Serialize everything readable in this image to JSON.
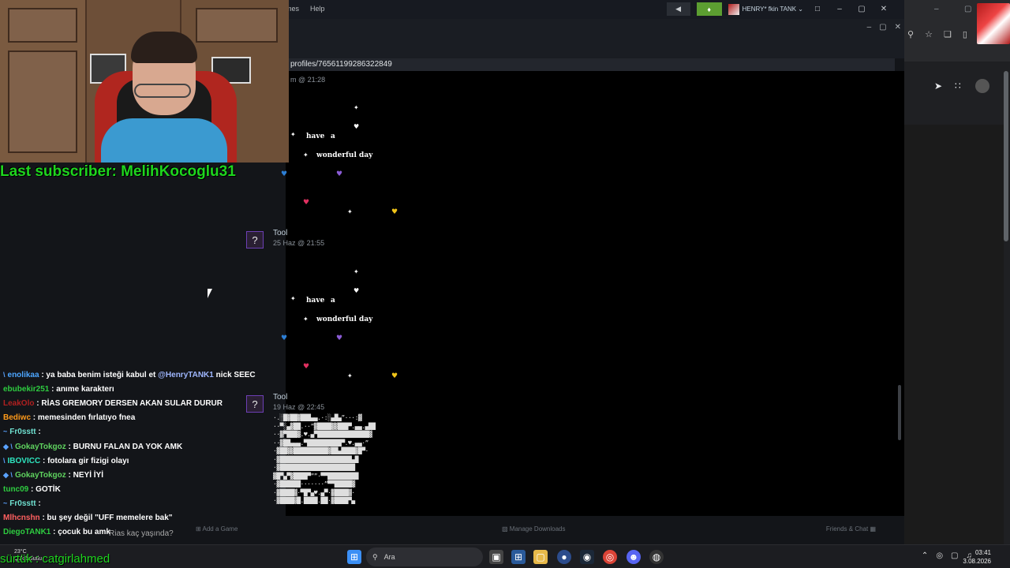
{
  "steam": {
    "menu": [
      "mes",
      "Help"
    ],
    "bell_icon": "bell-icon",
    "user_name": "HENRY* fkin TANK ⌄",
    "url": "profiles/76561199286322849",
    "first_ts": "m @ 21:28",
    "comments": [
      {
        "author": "Tool",
        "avatar_glyph": "?",
        "timestamp": "25 Haz @ 21:55"
      },
      {
        "author": "Tool",
        "avatar_glyph": "?",
        "timestamp": "19 Haz @ 22:45"
      }
    ],
    "art_words": {
      "have": "have",
      "a": "a",
      "wonderful_day": "wonderful day"
    },
    "ascii_art": "·.░█▓██▓███▄▄.·:░▄█▄”···:▓\n··▀░▄▓██.··”▓████▓▓███▀.▄▄.▄██\n··▓▀███▓.♥.▄▀███████████████▓\n··▓██▄▄▄.▀██████████▀.♥.▄▄·”\n·▓██▓▓██████████▓██▄████▓█▀·\n·▓█████████████████████▄█\n·▓██████████████████████\n▓█▀▄▀▓████▀””·▀▀█████████\n·▓██████·······”▀▀█████▓\n·▓████▓·▀█▀▄♥.▄▀·▓████▓·\n·▓████▓█.████.██·▓████▀▄",
    "bottom": {
      "add_game": "Add a Game",
      "manage_downloads": "Manage Downloads",
      "friends_chat": "Friends & Chat"
    }
  },
  "stream": {
    "last_subscriber": "Last subscriber: MelihKocoglu31",
    "status": "sürtük : catgirlahmed",
    "chat_input_placeholder": "Rias kaç yaşında?",
    "chat": [
      {
        "badge": "\\",
        "user": "enolikaa",
        "color": "#4da6ff",
        "msg": " : ya baba benim isteği kabul et ",
        "mention": "@HenryTANK1",
        "tail": " nick SEEC"
      },
      {
        "badge": "",
        "user": "ebubekir251",
        "color": "#2ecc40",
        "msg": " : anıme karakterı",
        "mention": "",
        "tail": ""
      },
      {
        "badge": "",
        "user": "LeakOlo",
        "color": "#b02020",
        "msg": " : RİAS GREMORY DERSEN AKAN SULAR DURUR",
        "mention": "",
        "tail": ""
      },
      {
        "badge": "",
        "user": "Bediwc",
        "color": "#ff9a1a",
        "msg": " : memesinden fırlatıyo fnea",
        "mention": "",
        "tail": ""
      },
      {
        "badge": "~",
        "user": "Fr0sstt",
        "color": "#6fe0d0",
        "msg": " :",
        "mention": "",
        "tail": ""
      },
      {
        "badge": "◆ \\",
        "user": "GokayTokgoz",
        "color": "#5fd35f",
        "msg": " : BURNU FALAN DA YOK AMK",
        "mention": "",
        "tail": ""
      },
      {
        "badge": "\\",
        "user": "IBOVICC",
        "color": "#2ee6c0",
        "msg": " : fotolara gir fizigi olayı",
        "mention": "",
        "tail": ""
      },
      {
        "badge": "◆ \\",
        "user": "GokayTokgoz",
        "color": "#5fd35f",
        "msg": " : NEYİ İYİ",
        "mention": "",
        "tail": ""
      },
      {
        "badge": "",
        "user": "tunc09",
        "color": "#2ecc40",
        "msg": " : GOTİK",
        "mention": "",
        "tail": ""
      },
      {
        "badge": "~",
        "user": "Fr0sstt",
        "color": "#6fe0d0",
        "msg": " :",
        "mention": "",
        "tail": ""
      },
      {
        "badge": "",
        "user": "Mlhcnshn",
        "color": "#ff6060",
        "msg": " : bu şey değil \"UFF memelere bak\"",
        "mention": "",
        "tail": ""
      },
      {
        "badge": "",
        "user": "DiegoTANK1",
        "color": "#2ecc40",
        "msg": " : çocuk bu amk",
        "mention": "",
        "tail": ""
      }
    ]
  },
  "taskbar": {
    "weather_temp": "23°C",
    "weather_desc": "Çok bulutlu",
    "search_label": "Ara",
    "time": "03:41",
    "date": "3.08.2026",
    "icons": [
      "windows-start-icon",
      "search-icon",
      "task-view-icon",
      "calculator-icon",
      "file-explorer-icon",
      "app-icon",
      "steam-icon",
      "chrome-icon",
      "discord-icon",
      "obs-icon"
    ]
  },
  "colors": {
    "steam_green": "#5c9e31",
    "subscriber_green": "#1ed51e",
    "tool_border": "#6d3fb5"
  }
}
